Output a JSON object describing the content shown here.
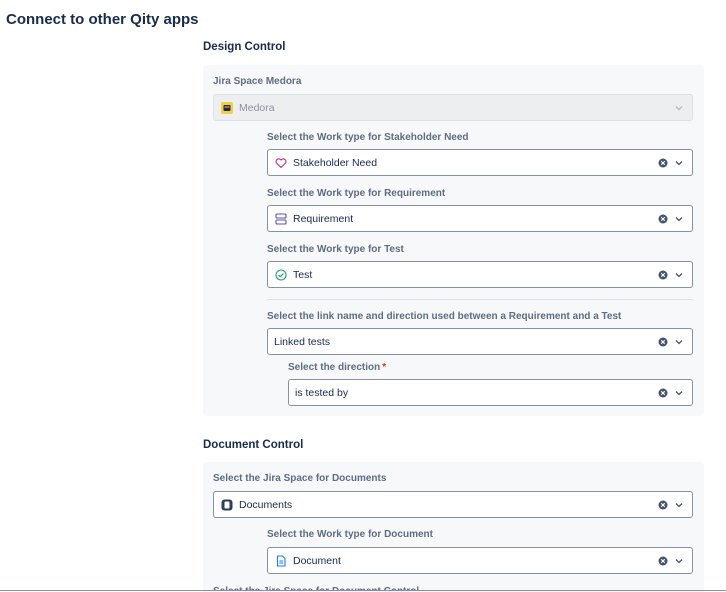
{
  "page_title": "Connect to other Qity apps",
  "design_control": {
    "title": "Design Control",
    "jira_space_label": "Jira Space Medora",
    "jira_space_value": "Medora",
    "stakeholder_label": "Select the Work type for Stakeholder Need",
    "stakeholder_value": "Stakeholder Need",
    "requirement_label": "Select the Work type for Requirement",
    "requirement_value": "Requirement",
    "test_label": "Select the Work type for Test",
    "test_value": "Test",
    "link_label": "Select the link name and direction used between a Requirement and a Test",
    "link_value": "Linked tests",
    "direction_label": "Select the direction",
    "direction_required": "*",
    "direction_value": "is tested by"
  },
  "document_control": {
    "title": "Document Control",
    "space_label": "Select the Jira Space for Documents",
    "space_value": "Documents",
    "doc_type_label": "Select the Work type for Document",
    "doc_type_value": "Document",
    "next_label": "Select the Jira Space for Document Control"
  },
  "icons": {
    "medora": "project-avatar-icon",
    "stakeholder": "heart-icon",
    "requirement": "requirement-icon",
    "test": "check-circle-icon",
    "documents": "documents-space-icon",
    "document": "document-icon",
    "clear": "clear-icon",
    "chevron": "chevron-down-icon"
  },
  "colors": {
    "heart": "#c9378a",
    "requirement": "#5e4db2",
    "test": "#22a06b",
    "document": "#1d7afc",
    "required": "#de350b"
  }
}
